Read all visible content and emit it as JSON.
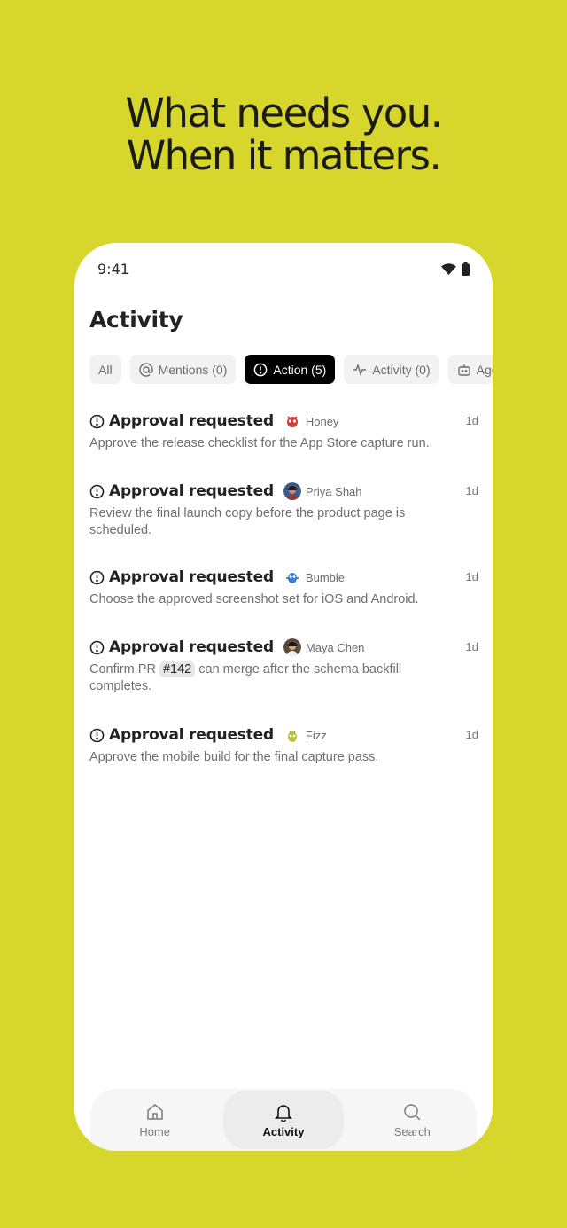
{
  "headline": {
    "line1": "What needs you.",
    "line2": "When it matters."
  },
  "status": {
    "time": "9:41"
  },
  "page": {
    "title": "Activity"
  },
  "filters": [
    {
      "label": "All",
      "icon": "none",
      "active": false
    },
    {
      "label": "Mentions (0)",
      "icon": "at-icon",
      "active": false
    },
    {
      "label": "Action (5)",
      "icon": "alert-circle-icon",
      "active": true
    },
    {
      "label": "Activity (0)",
      "icon": "pulse-icon",
      "active": false
    },
    {
      "label": "Age",
      "icon": "bot-icon",
      "active": false
    }
  ],
  "feed": [
    {
      "title": "Approval requested",
      "who": "Honey",
      "age": "1d",
      "body": "Approve the release checklist for the App Store capture run."
    },
    {
      "title": "Approval requested",
      "who": "Priya Shah",
      "age": "1d",
      "body": "Review the final launch copy before the product page is scheduled."
    },
    {
      "title": "Approval requested",
      "who": "Bumble",
      "age": "1d",
      "body": "Choose the approved screenshot set for iOS and Android."
    },
    {
      "title": "Approval requested",
      "who": "Maya Chen",
      "age": "1d",
      "body_before": "Confirm PR",
      "pr": "#142",
      "body_after": "can merge after the schema backfill completes."
    },
    {
      "title": "Approval requested",
      "who": "Fizz",
      "age": "1d",
      "body": "Approve the mobile build for the final capture pass."
    }
  ],
  "tabbar": {
    "home": "Home",
    "activity": "Activity",
    "search": "Search"
  },
  "colors": {
    "background": "#d6d62c",
    "active_chip": "#000000"
  }
}
